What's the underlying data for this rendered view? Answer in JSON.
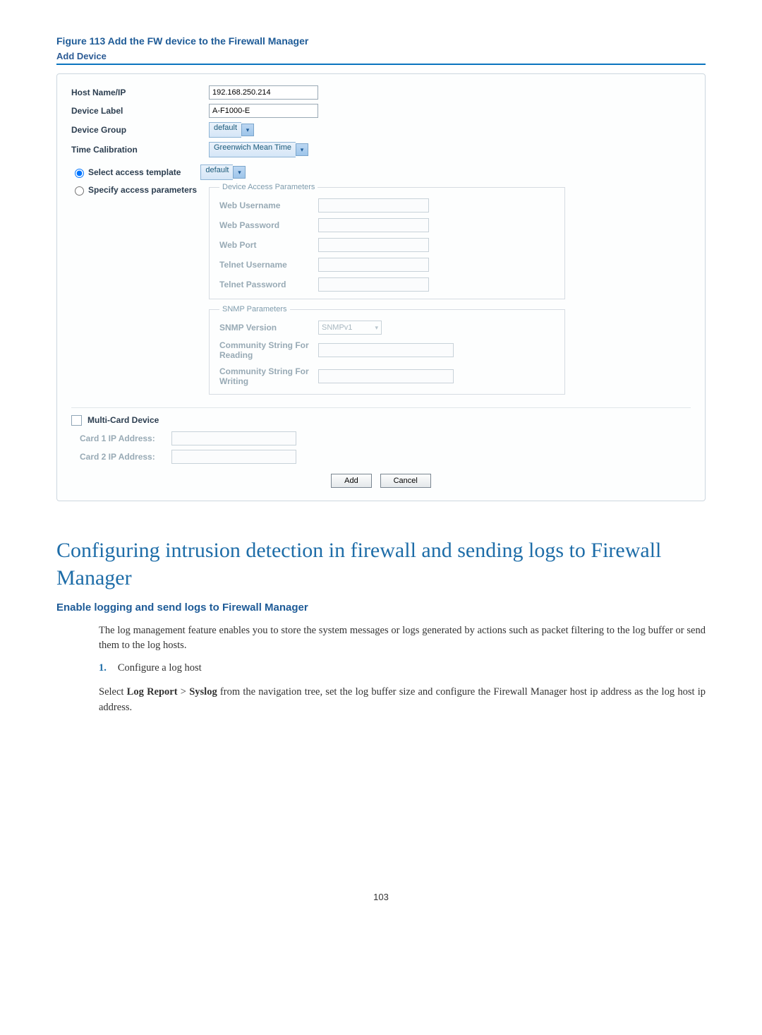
{
  "figure_title": "Figure 113 Add the FW device to the Firewall Manager",
  "panel_title": "Add Device",
  "fields": {
    "host_label": "Host Name/IP",
    "host_value": "192.168.250.214",
    "device_label_label": "Device Label",
    "device_label_value": "A-F1000-E",
    "device_group_label": "Device Group",
    "device_group_value": "default",
    "time_calib_label": "Time Calibration",
    "time_calib_value": "Greenwich Mean Time"
  },
  "radios": {
    "select_template_label": "Select access template",
    "select_template_value": "default",
    "specify_params_label": "Specify access parameters"
  },
  "device_access": {
    "legend": "Device Access Parameters",
    "web_username": "Web Username",
    "web_password": "Web Password",
    "web_port": "Web Port",
    "telnet_username": "Telnet Username",
    "telnet_password": "Telnet Password"
  },
  "snmp": {
    "legend": "SNMP Parameters",
    "version_label": "SNMP Version",
    "version_value": "SNMPv1",
    "comm_read": "Community String For Reading",
    "comm_write": "Community String For Writing"
  },
  "multicard": {
    "checkbox_label": "Multi-Card Device",
    "card1": "Card 1 IP Address:",
    "card2": "Card 2 IP Address:"
  },
  "buttons": {
    "add": "Add",
    "cancel": "Cancel"
  },
  "section_heading": "Configuring intrusion detection in firewall and sending logs to Firewall Manager",
  "subheading": "Enable logging and send logs to Firewall Manager",
  "para1": "The log management feature enables you to store the system messages or logs generated by actions such as packet filtering to the log buffer or send them to the log hosts.",
  "list1_num": "1.",
  "list1_text": "Configure a log host",
  "para2_pre": "Select ",
  "para2_b1": "Log Report",
  "para2_gt": " > ",
  "para2_b2": "Syslog",
  "para2_post": " from the navigation tree, set the log buffer size and configure the Firewall Manager host  ip address as the log host ip address.",
  "page_number": "103"
}
